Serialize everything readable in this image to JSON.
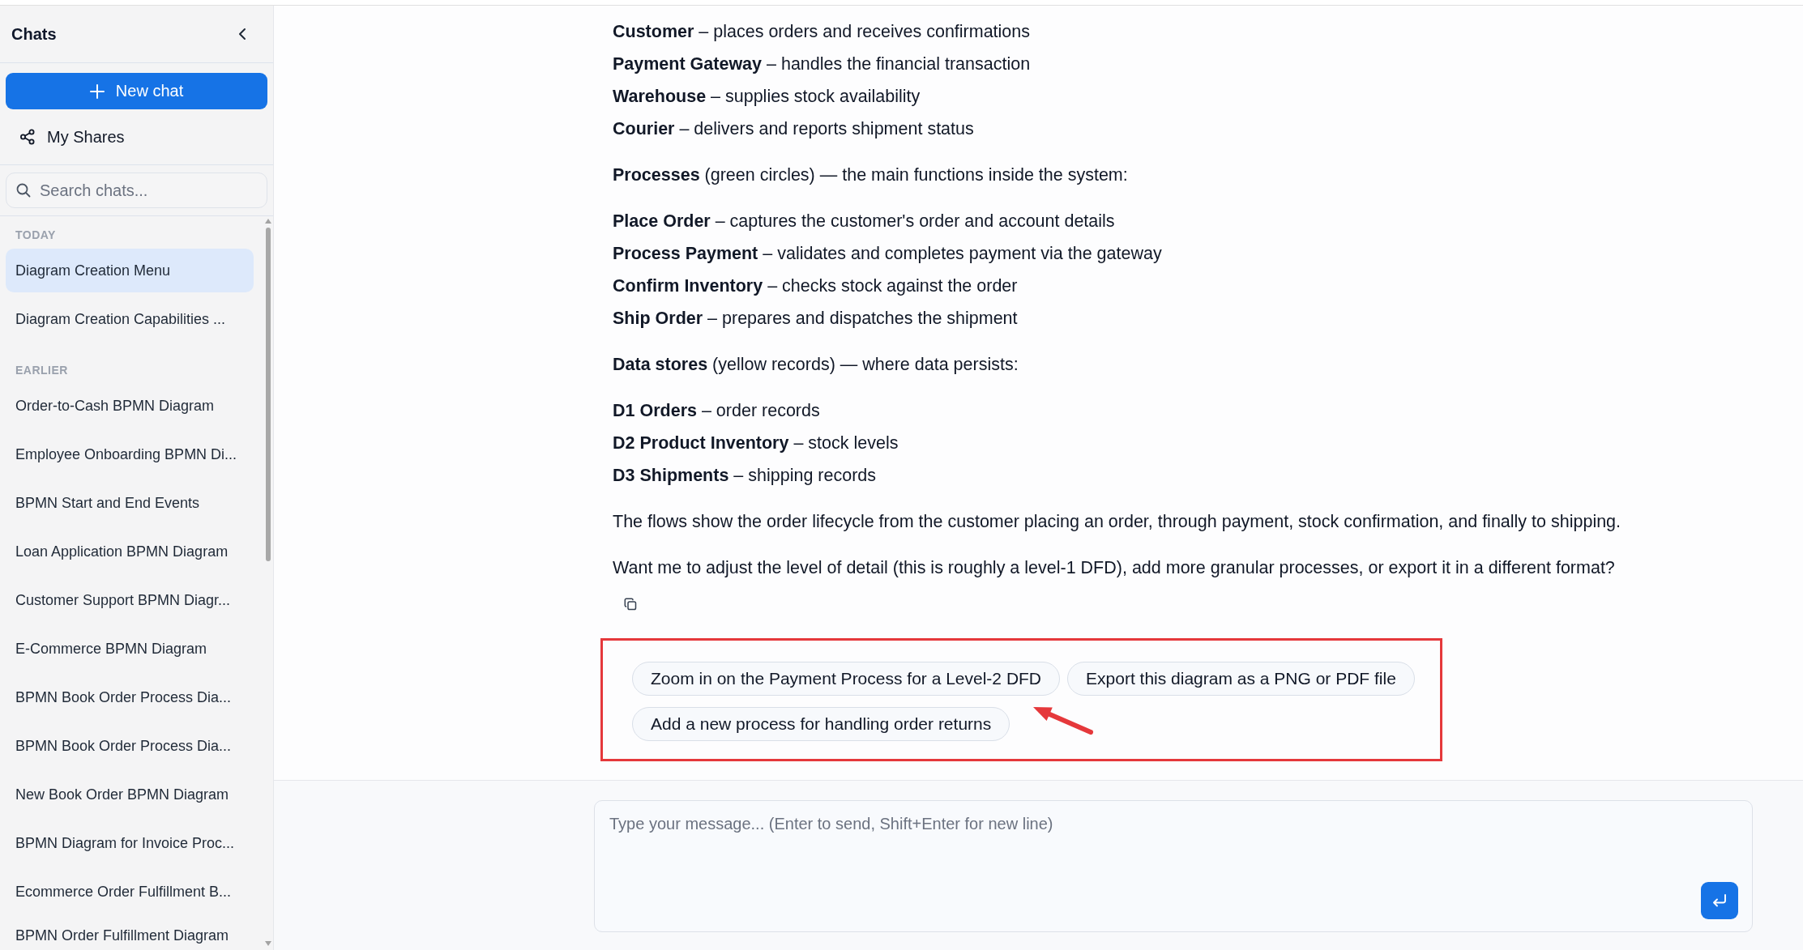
{
  "sidebar": {
    "title": "Chats",
    "new_chat_button": "New chat",
    "my_shares": "My Shares",
    "search": {
      "placeholder": "Search chats..."
    },
    "sections": [
      {
        "label": "TODAY",
        "items": [
          {
            "title": "Diagram Creation Menu",
            "selected": true
          },
          {
            "title": "Diagram Creation Capabilities ...",
            "selected": false
          }
        ]
      },
      {
        "label": "EARLIER",
        "items": [
          {
            "title": "Order-to-Cash BPMN Diagram",
            "selected": false
          },
          {
            "title": "Employee Onboarding BPMN Di...",
            "selected": false
          },
          {
            "title": "BPMN Start and End Events",
            "selected": false
          },
          {
            "title": "Loan Application BPMN Diagram",
            "selected": false
          },
          {
            "title": "Customer Support BPMN Diagr...",
            "selected": false
          },
          {
            "title": "E-Commerce BPMN Diagram",
            "selected": false
          },
          {
            "title": "BPMN Book Order Process Dia...",
            "selected": false
          },
          {
            "title": "BPMN Book Order Process Dia...",
            "selected": false
          },
          {
            "title": "New Book Order BPMN Diagram",
            "selected": false
          },
          {
            "title": "BPMN Diagram for Invoice Proc...",
            "selected": false
          },
          {
            "title": "Ecommerce Order Fulfillment B...",
            "selected": false
          },
          {
            "title": "BPMN Order Fulfillment Diagram",
            "selected": false
          }
        ]
      }
    ]
  },
  "message": {
    "blocks": [
      {
        "kind": "list",
        "items": [
          "**Customer** – places orders and receives confirmations",
          "**Payment Gateway** – handles the financial transaction",
          "**Warehouse** – supplies stock availability",
          "**Courier** – delivers and reports shipment status"
        ]
      },
      {
        "kind": "paragraph",
        "text": "**Processes** (green circles) — the main functions inside the system:"
      },
      {
        "kind": "list",
        "items": [
          "**Place Order** – captures the customer's order and account details",
          "**Process Payment** – validates and completes payment via the gateway",
          "**Confirm Inventory** – checks stock against the order",
          "**Ship Order** – prepares and dispatches the shipment"
        ]
      },
      {
        "kind": "paragraph",
        "text": "**Data stores** (yellow records) — where data persists:"
      },
      {
        "kind": "list",
        "items": [
          "**D1 Orders** – order records",
          "**D2 Product Inventory** – stock levels",
          "**D3 Shipments** – shipping records"
        ]
      },
      {
        "kind": "paragraph",
        "text": "The flows show the order lifecycle from the customer placing an order, through payment, stock confirmation, and finally to shipping."
      },
      {
        "kind": "paragraph",
        "text": "Want me to adjust the level of detail (this is roughly a level-1 DFD), add more granular processes, or export it in a different format?"
      }
    ]
  },
  "suggestions": [
    "Zoom in on the Payment Process for a Level-2 DFD",
    "Export this diagram as a PNG or PDF file",
    "Add a new process for handling order returns"
  ],
  "composer": {
    "placeholder": "Type your message... (Enter to send, Shift+Enter for new line)"
  }
}
